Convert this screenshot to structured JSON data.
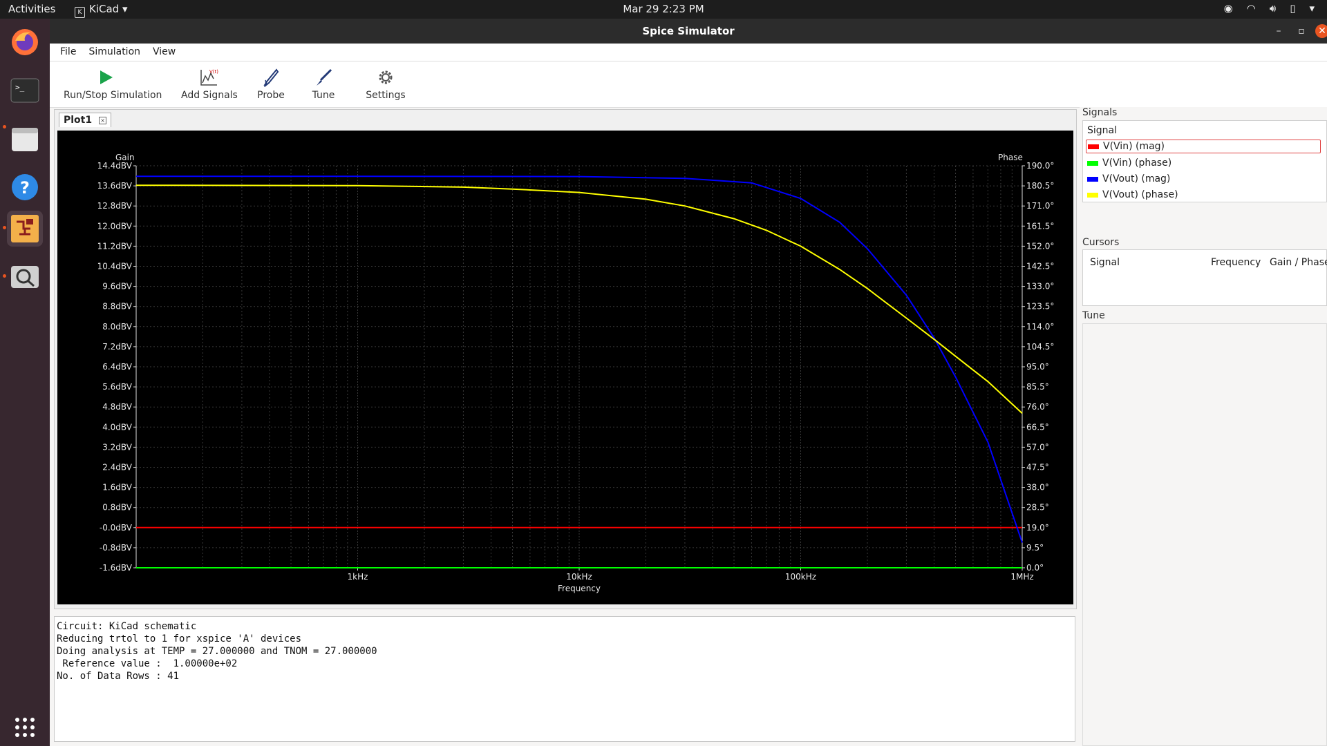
{
  "topbar": {
    "activities": "Activities",
    "app_name": "KiCad",
    "clock": "Mar 29  2:23 PM"
  },
  "window": {
    "title": "Spice Simulator"
  },
  "menu": [
    "File",
    "Simulation",
    "View"
  ],
  "toolbar": {
    "run_stop": "Run/Stop Simulation",
    "add_signals": "Add Signals",
    "probe": "Probe",
    "tune": "Tune",
    "settings": "Settings"
  },
  "plot_tab": {
    "label": "Plot1"
  },
  "chart_data": {
    "type": "line",
    "left_axis_title": "Gain",
    "right_axis_title": "Phase",
    "xlabel": "Frequency",
    "x_scale": "log",
    "x_range_hz": [
      100,
      1000000
    ],
    "x_tick_labels": [
      "1kHz",
      "10kHz",
      "100kHz",
      "1MHz"
    ],
    "gain_ticks": [
      "14.4dBV",
      "13.6dBV",
      "12.8dBV",
      "12.0dBV",
      "11.2dBV",
      "10.4dBV",
      "9.6dBV",
      "8.8dBV",
      "8.0dBV",
      "7.2dBV",
      "6.4dBV",
      "5.6dBV",
      "4.8dBV",
      "4.0dBV",
      "3.2dBV",
      "2.4dBV",
      "1.6dBV",
      "0.8dBV",
      "-0.0dBV",
      "-0.8dBV",
      "-1.6dBV"
    ],
    "phase_ticks": [
      "190.0°",
      "180.5°",
      "171.0°",
      "161.5°",
      "152.0°",
      "142.5°",
      "133.0°",
      "123.5°",
      "114.0°",
      "104.5°",
      "95.0°",
      "85.5°",
      "76.0°",
      "66.5°",
      "57.0°",
      "47.5°",
      "38.0°",
      "28.5°",
      "19.0°",
      "9.5°",
      "0.0°"
    ],
    "gain_range_dBV": [
      -1.6,
      14.4
    ],
    "phase_range_deg": [
      0,
      190
    ],
    "grid": true,
    "series": [
      {
        "name": "V(Vin) (mag)",
        "color": "#ff0000",
        "axis": "gain",
        "x": [
          100,
          1000,
          10000,
          100000,
          1000000
        ],
        "y": [
          0,
          0,
          0,
          0,
          0
        ]
      },
      {
        "name": "V(Vin) (phase)",
        "color": "#00ff00",
        "axis": "phase",
        "x": [
          100,
          1000,
          10000,
          100000,
          1000000
        ],
        "y": [
          0,
          0,
          0,
          0,
          0
        ]
      },
      {
        "name": "V(Vout) (mag)",
        "color": "#0000ff",
        "axis": "gain",
        "x": [
          100,
          1000,
          10000,
          30000,
          60000,
          100000,
          150000,
          200000,
          300000,
          400000,
          500000,
          700000,
          1000000
        ],
        "y": [
          13.98,
          13.98,
          13.97,
          13.9,
          13.72,
          13.1,
          12.15,
          11.1,
          9.25,
          7.55,
          6.0,
          3.4,
          -0.6
        ]
      },
      {
        "name": "V(Vout) (phase)",
        "color": "#ffff00",
        "axis": "phase",
        "x": [
          100,
          1000,
          3000,
          5000,
          10000,
          20000,
          30000,
          50000,
          70000,
          100000,
          150000,
          200000,
          300000,
          400000,
          500000,
          700000,
          1000000
        ],
        "y": [
          180.8,
          180.6,
          179.9,
          179.0,
          177.4,
          174.2,
          171.0,
          165.0,
          159.5,
          152.0,
          141.0,
          132.0,
          118.0,
          108.0,
          100.0,
          88.0,
          73.0
        ]
      }
    ]
  },
  "console_lines": [
    "Circuit: KiCad schematic",
    "Reducing trtol to 1 for xspice 'A' devices",
    "Doing analysis at TEMP = 27.000000 and TNOM = 27.000000",
    " Reference value :  1.00000e+02",
    "No. of Data Rows : 41"
  ],
  "signals_panel": {
    "group_label": "Signals",
    "header": "Signal",
    "items": [
      {
        "label": "V(Vin) (mag)",
        "color": "#ff0000"
      },
      {
        "label": "V(Vin) (phase)",
        "color": "#00ff00"
      },
      {
        "label": "V(Vout) (mag)",
        "color": "#0000ff"
      },
      {
        "label": "V(Vout) (phase)",
        "color": "#ffff00"
      }
    ]
  },
  "cursors_panel": {
    "group_label": "Cursors",
    "col_signal": "Signal",
    "col_frequency": "Frequency",
    "col_gain_phase": "Gain / Phase"
  },
  "tune_panel": {
    "group_label": "Tune"
  }
}
